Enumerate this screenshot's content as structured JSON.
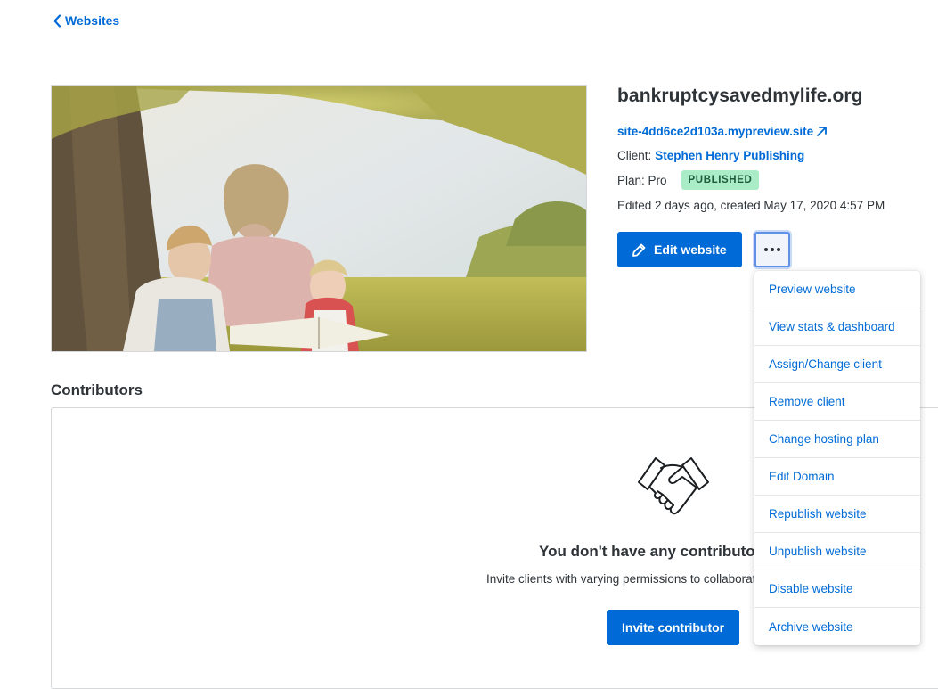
{
  "nav": {
    "back_label": "Websites"
  },
  "site": {
    "title": "bankruptcysavedmylife.org",
    "preview_url": "site-4dd6ce2d103a.mypreview.site",
    "client_prefix": "Client:",
    "client_name": "Stephen Henry Publishing",
    "plan_label": "Plan: Pro",
    "status_badge": "PUBLISHED",
    "edited_info": "Edited 2 days ago, created May 17, 2020 4:57 PM"
  },
  "actions": {
    "edit_label": "Edit website"
  },
  "contributors": {
    "section_title": "Contributors",
    "empty_title": "You don't have any contributors",
    "empty_desc": "Invite clients with varying permissions to collaborate on this website.",
    "invite_label": "Invite contributor"
  },
  "menu": {
    "items": [
      "Preview website",
      "View stats & dashboard",
      "Assign/Change client",
      "Remove client",
      "Change hosting plan",
      "Edit Domain",
      "Republish website",
      "Unpublish website",
      "Disable website",
      "Archive website"
    ]
  },
  "colors": {
    "accent": "#006bd6",
    "badge_bg": "#a9ecc6",
    "badge_text": "#1d5a3a",
    "text": "#2e3338",
    "border": "#d5d7d9"
  },
  "icons": {
    "back": "chevron-left-icon",
    "external": "external-link-icon",
    "edit": "pencil-icon",
    "more": "more-horizontal-icon",
    "empty_state": "handshake-icon"
  }
}
